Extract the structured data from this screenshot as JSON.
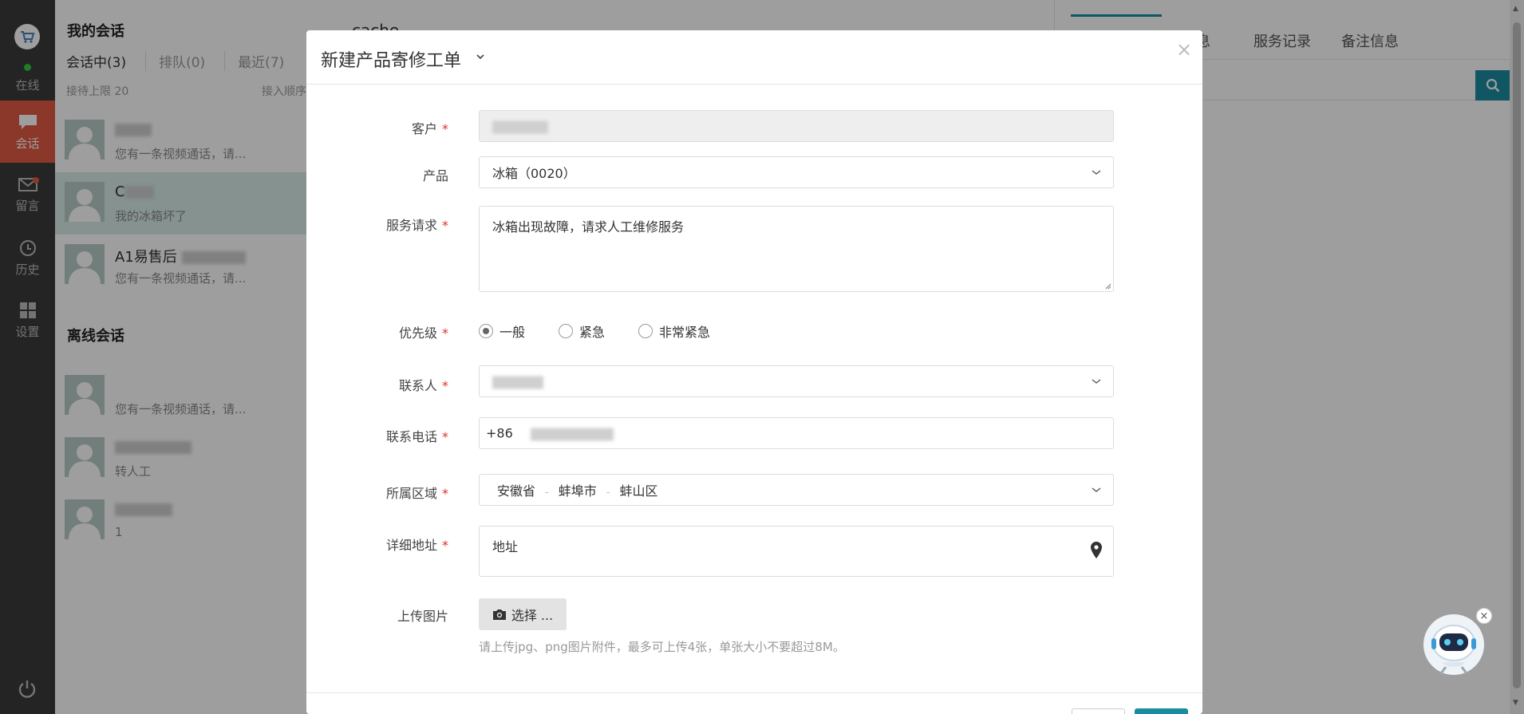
{
  "nav": {
    "status_label": "在线",
    "items": [
      {
        "label": "会话",
        "icon": "chat-icon"
      },
      {
        "label": "留言",
        "icon": "mail-icon"
      },
      {
        "label": "历史",
        "icon": "clock-icon"
      },
      {
        "label": "设置",
        "icon": "grid-icon"
      }
    ]
  },
  "sessions": {
    "title": "我的会话",
    "tabs": [
      "会话中(3)",
      "排队(0)",
      "最近(7)"
    ],
    "limit_label": "接待上限 20",
    "order_label": "接入顺序",
    "active": [
      {
        "name": "",
        "message": "您有一条视频通话，请..."
      },
      {
        "name": "C",
        "message": "我的冰箱坏了"
      },
      {
        "name": "A1易售后",
        "message": "您有一条视频通话，请..."
      }
    ],
    "offline_title": "离线会话",
    "offline": [
      {
        "name": "",
        "message": "您有一条视频通话，请..."
      },
      {
        "name": "",
        "message": "转人工"
      },
      {
        "name": "",
        "message": "1"
      }
    ]
  },
  "main_header": {
    "title": "cache"
  },
  "right_panel": {
    "tabs": [
      "息",
      "服务记录",
      "备注信息"
    ]
  },
  "modal": {
    "title": "新建产品寄修工单",
    "close": "×",
    "fields": {
      "customer_label": "客户",
      "product_label": "产品",
      "product_value": "冰箱（0020）",
      "request_label": "服务请求",
      "request_value": "冰箱出现故障，请求人工维修服务",
      "priority_label": "优先级",
      "priority_options": [
        "一般",
        "紧急",
        "非常紧急"
      ],
      "contact_label": "联系人",
      "phone_label": "联系电话",
      "phone_prefix": "+86",
      "region_label": "所属区域",
      "region_parts": [
        "安徽省",
        "蚌埠市",
        "蚌山区"
      ],
      "region_sep": "-",
      "address_label": "详细地址",
      "address_value": "地址",
      "upload_label": "上传图片",
      "upload_button": "选择 ...",
      "upload_hint": "请上传jpg、png图片附件，最多可上传4张，单张大小不要超过8M。"
    },
    "required_mark": "*"
  },
  "colors": {
    "accent": "#1a8ca0",
    "nav_active": "#e05a43",
    "required": "#e0302a"
  }
}
